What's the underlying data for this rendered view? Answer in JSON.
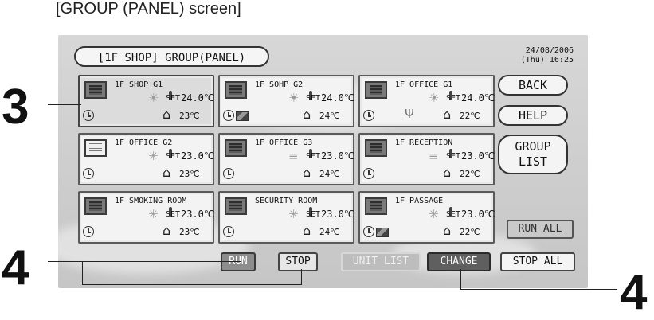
{
  "caption": "[GROUP (PANEL) screen]",
  "header": {
    "title": "[1F SHOP] GROUP(PANEL)",
    "date": "24/08/2006",
    "time": "(Thu) 16:25"
  },
  "set_label": "SET",
  "groups": [
    {
      "name": "1F SHOP G1",
      "mode_icon": "sun-icon",
      "set_temp": "24.0℃",
      "room_temp": "23℃",
      "unit_on": true,
      "selected": true,
      "filter": false,
      "maintenance": false
    },
    {
      "name": "1F SOHP G2",
      "mode_icon": "sun-icon",
      "set_temp": "24.0℃",
      "room_temp": "24℃",
      "unit_on": true,
      "selected": false,
      "filter": true,
      "maintenance": false
    },
    {
      "name": "1F OFFICE G1",
      "mode_icon": "sun-icon",
      "set_temp": "24.0℃",
      "room_temp": "22℃",
      "unit_on": true,
      "selected": false,
      "filter": false,
      "maintenance": true
    },
    {
      "name": "1F OFFICE G2",
      "mode_icon": "snowflake-icon",
      "set_temp": "23.0℃",
      "room_temp": "23℃",
      "unit_on": false,
      "selected": false,
      "filter": false,
      "maintenance": false
    },
    {
      "name": "1F OFFICE G3",
      "mode_icon": "fan-icon",
      "set_temp": "23.0℃",
      "room_temp": "24℃",
      "unit_on": true,
      "selected": false,
      "filter": false,
      "maintenance": false
    },
    {
      "name": "1F RECEPTION",
      "mode_icon": "fan-icon",
      "set_temp": "23.0℃",
      "room_temp": "22℃",
      "unit_on": true,
      "selected": false,
      "filter": false,
      "maintenance": false
    },
    {
      "name": "1F SMOKING ROOM",
      "mode_icon": "snowflake-icon",
      "set_temp": "23.0℃",
      "room_temp": "23℃",
      "unit_on": true,
      "selected": false,
      "filter": false,
      "maintenance": false
    },
    {
      "name": "SECURITY ROOM",
      "mode_icon": "snowflake-icon",
      "set_temp": "23.0℃",
      "room_temp": "24℃",
      "unit_on": true,
      "selected": false,
      "filter": false,
      "maintenance": false
    },
    {
      "name": "1F PASSAGE",
      "mode_icon": "snowflake-icon",
      "set_temp": "23.0℃",
      "room_temp": "22℃",
      "unit_on": true,
      "selected": false,
      "filter": true,
      "maintenance": false
    }
  ],
  "side_buttons": {
    "back": "BACK",
    "help": "HELP",
    "group_list": "GROUP\nLIST"
  },
  "bottom_buttons": {
    "run": "RUN",
    "stop": "STOP",
    "unit_list": "UNIT LIST",
    "change": "CHANGE",
    "run_all": "RUN ALL",
    "stop_all": "STOP ALL"
  },
  "callouts": {
    "label_3": "3",
    "label_4_left": "4",
    "label_4_right": "4"
  }
}
